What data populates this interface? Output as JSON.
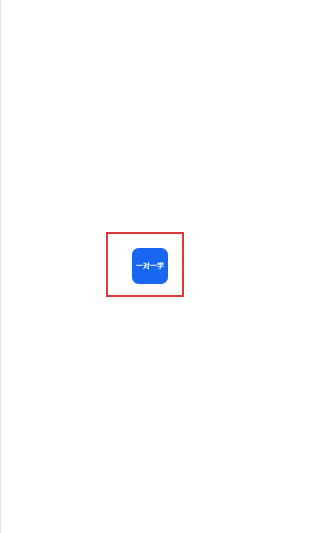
{
  "app_icon": {
    "label": "一对一学",
    "color": "#1767f2",
    "label_color": "#ffffff"
  },
  "highlight": {
    "color": "#d93a3a"
  },
  "background": "#ffffff"
}
